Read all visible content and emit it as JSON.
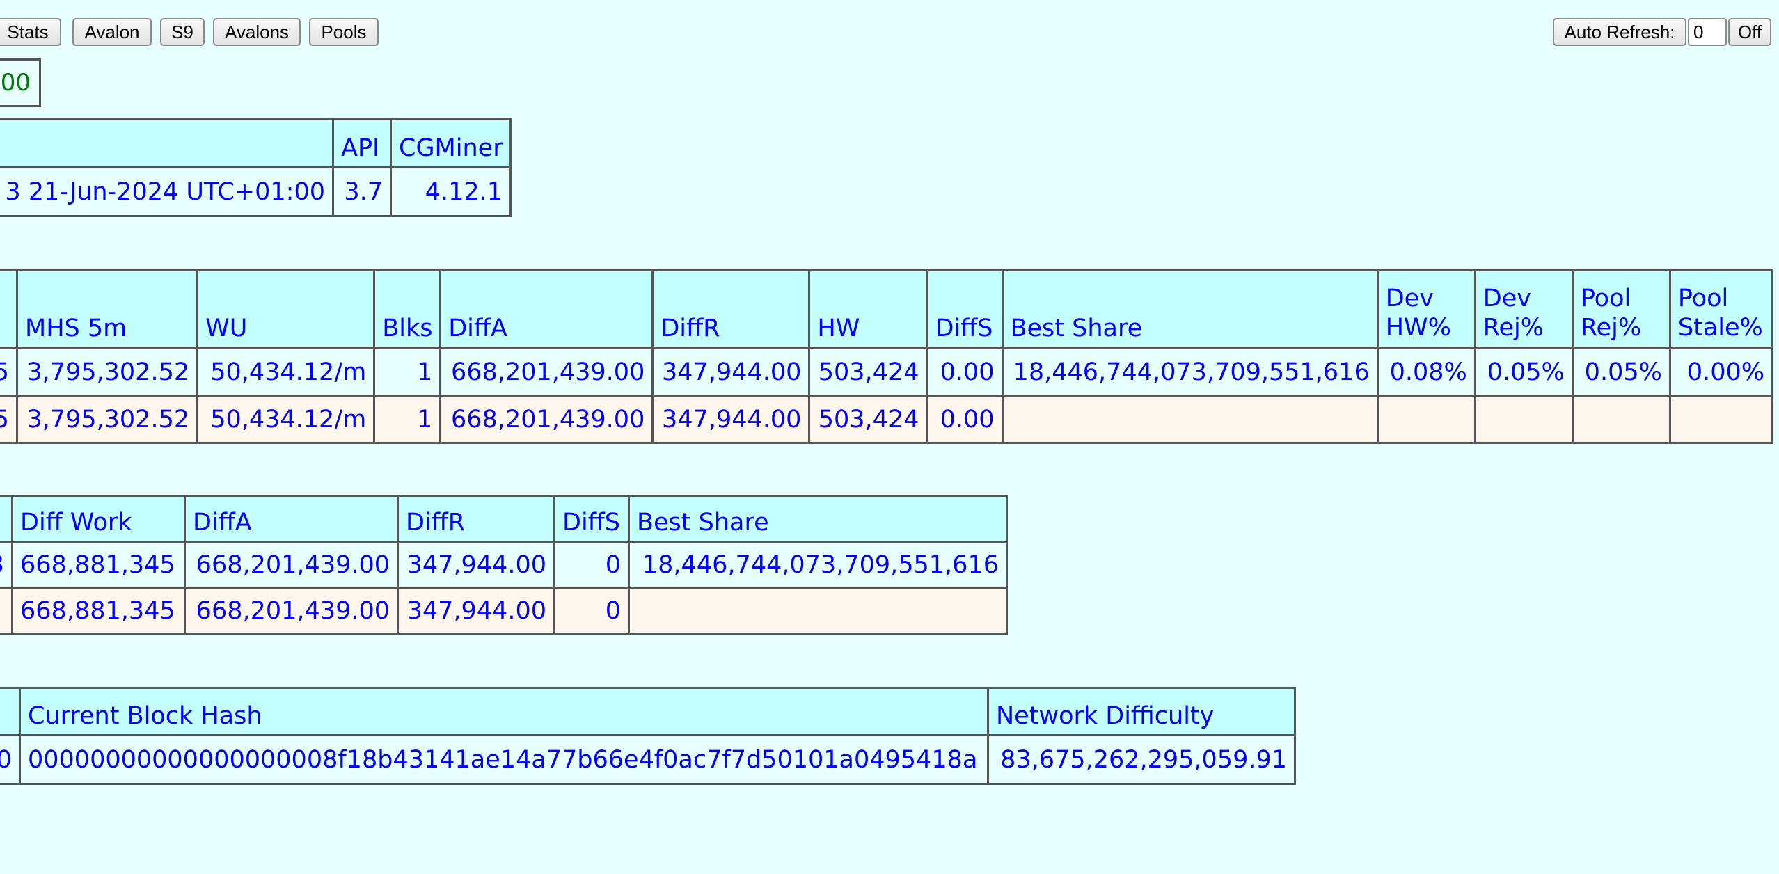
{
  "toolbar": {
    "buttons": [
      "Stats",
      "Avalon",
      "S9",
      "Avalons",
      "Pools"
    ],
    "auto_refresh_label": "Auto Refresh:",
    "auto_refresh_value": "0",
    "off_label": "Off"
  },
  "summary_box": {
    "value": "00"
  },
  "version_table": {
    "headers": [
      "",
      "API",
      "CGMiner"
    ],
    "row": [
      "3 21-Jun-2024 UTC+01:00",
      "3.7",
      "4.12.1"
    ]
  },
  "device_table": {
    "headers": [
      "",
      "MHS 5m",
      "WU",
      "Blks",
      "DiffA",
      "DiffR",
      "HW",
      "DiffS",
      "Best Share",
      "Dev HW%",
      "Dev Rej%",
      "Pool Rej%",
      "Pool Stale%"
    ],
    "rows": [
      [
        "5",
        "3,795,302.52",
        "50,434.12/m",
        "1",
        "668,201,439.00",
        "347,944.00",
        "503,424",
        "0.00",
        "18,446,744,073,709,551,616",
        "0.08%",
        "0.05%",
        "0.05%",
        "0.00%"
      ],
      [
        "5",
        "3,795,302.52",
        "50,434.12/m",
        "1",
        "668,201,439.00",
        "347,944.00",
        "503,424",
        "0.00",
        "",
        "",
        "",
        "",
        ""
      ]
    ]
  },
  "pool_table": {
    "headers": [
      "",
      "Diff Work",
      "DiffA",
      "DiffR",
      "DiffS",
      "Best Share"
    ],
    "rows": [
      [
        "3",
        "668,881,345",
        "668,201,439.00",
        "347,944.00",
        "0",
        "18,446,744,073,709,551,616"
      ],
      [
        "",
        "668,881,345",
        "668,201,439.00",
        "347,944.00",
        "0",
        ""
      ]
    ]
  },
  "block_table": {
    "headers": [
      "",
      "Current Block Hash",
      "Network Difficulty"
    ],
    "row": [
      "0",
      "00000000000000000008f18b43141ae14a77b66e4f0ac7f7d50101a0495418a",
      "83,675,262,295,059.91"
    ]
  }
}
